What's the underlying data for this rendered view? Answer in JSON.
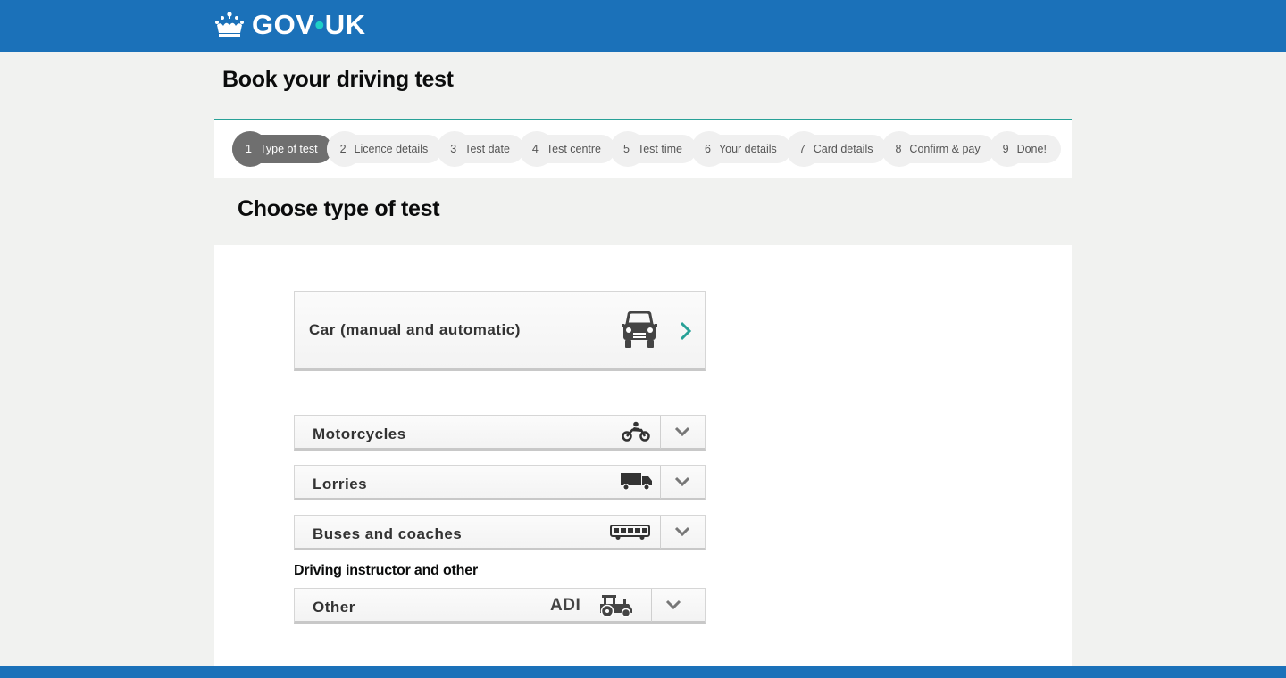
{
  "header": {
    "logo_text_left": "GOV",
    "logo_dot": "•",
    "logo_text_right": "UK"
  },
  "page_title": "Book your driving test",
  "steps": [
    {
      "num": "1",
      "label": "Type of test",
      "active": true
    },
    {
      "num": "2",
      "label": "Licence details"
    },
    {
      "num": "3",
      "label": "Test date"
    },
    {
      "num": "4",
      "label": "Test centre"
    },
    {
      "num": "5",
      "label": "Test time"
    },
    {
      "num": "6",
      "label": "Your details"
    },
    {
      "num": "7",
      "label": "Card details"
    },
    {
      "num": "8",
      "label": "Confirm & pay"
    },
    {
      "num": "9",
      "label": "Done!"
    }
  ],
  "section_heading": "Choose type of test",
  "options": {
    "car": {
      "label": "Car (manual and automatic)",
      "icon": "car-icon"
    },
    "motorcycles": {
      "label": "Motorcycles",
      "icon": "motorcycle-icon"
    },
    "lorries": {
      "label": "Lorries",
      "icon": "lorry-icon"
    },
    "buses": {
      "label": "Buses and coaches",
      "icon": "bus-icon"
    },
    "other_heading": "Driving instructor and other",
    "other": {
      "label": "Other",
      "badge": "ADI",
      "icon": "tractor-icon"
    }
  },
  "colors": {
    "header_blue": "#1b71b9",
    "accent_teal": "#28a197",
    "step_active": "#6f6f6f"
  }
}
